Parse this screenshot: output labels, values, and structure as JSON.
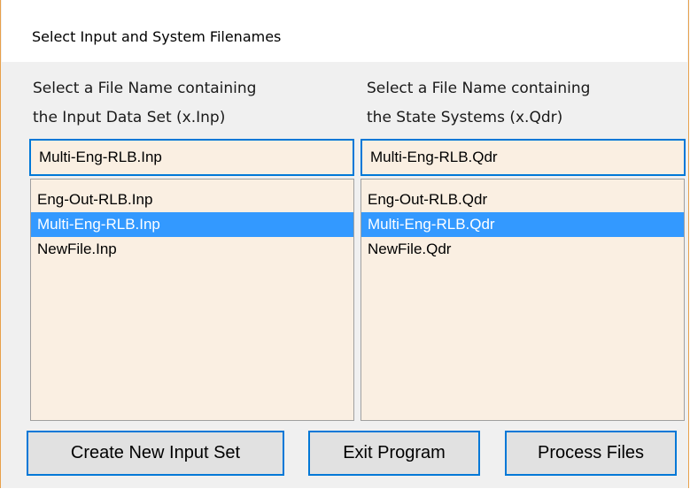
{
  "window": {
    "title": "Select Input and System Filenames"
  },
  "left_panel": {
    "prompt_line1": "Select a File Name containing",
    "prompt_line2": "the Input Data Set (x.Inp)",
    "selected_file": "Multi-Eng-RLB.Inp",
    "files": [
      "Eng-Out-RLB.Inp",
      "Multi-Eng-RLB.Inp",
      "NewFile.Inp"
    ],
    "selected_index": 1
  },
  "right_panel": {
    "prompt_line1": "Select a File Name containing",
    "prompt_line2": "the State Systems (x.Qdr)",
    "selected_file": "Multi-Eng-RLB.Qdr",
    "files": [
      "Eng-Out-RLB.Qdr",
      "Multi-Eng-RLB.Qdr",
      "NewFile.Qdr"
    ],
    "selected_index": 1
  },
  "buttons": {
    "create_label": "Create New Input Set",
    "exit_label": "Exit Program",
    "process_label": "Process Files"
  },
  "colors": {
    "selection": "#3399ff",
    "field_background": "#faefe2",
    "focus_border": "#0078d7",
    "window_border": "#e8a04a"
  }
}
